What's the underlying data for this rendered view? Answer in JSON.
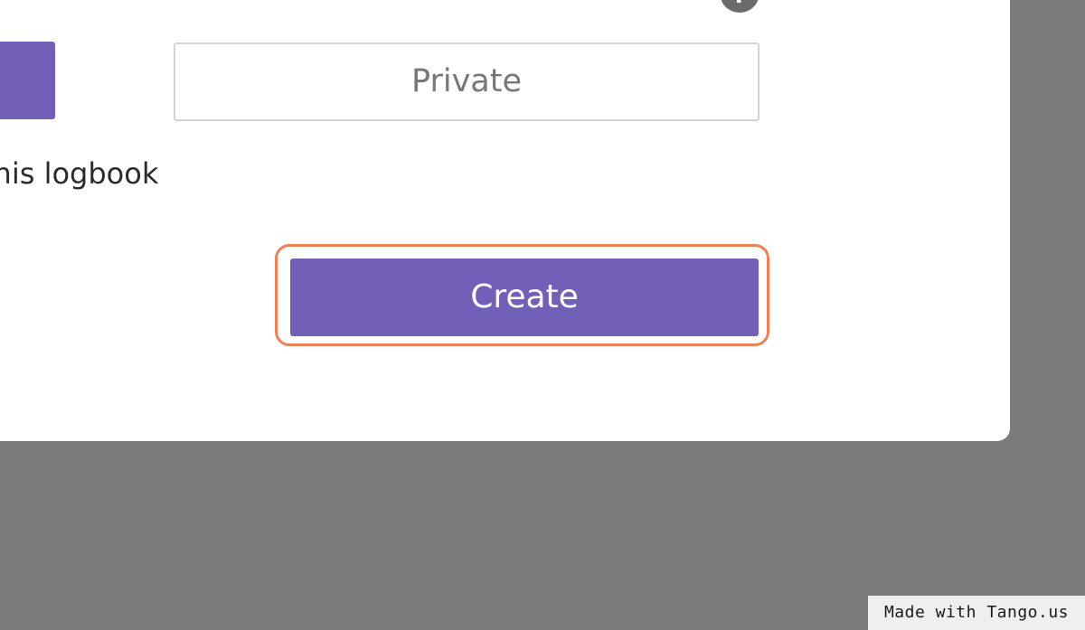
{
  "modal": {
    "visibility_buttons": {
      "private_label": "Private"
    },
    "description_fragment": "this logbook",
    "create_label": "Create",
    "help_icon_text": "?"
  },
  "watermark": {
    "text": "Made with Tango.us"
  },
  "colors": {
    "accent": "#715fb8",
    "highlight": "#f07f52",
    "overlay": "#7b7b7b"
  },
  "icons": {
    "help": "question-mark-circle-icon"
  }
}
